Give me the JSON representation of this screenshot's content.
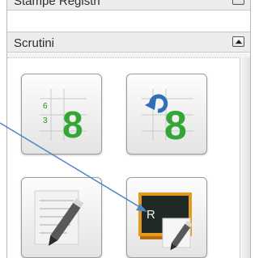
{
  "sections": {
    "stampe": {
      "title": "Stampe Registri"
    },
    "scrutini": {
      "title": "Scrutini"
    }
  },
  "tiles": [
    {
      "name": "tile-grade-8-grid",
      "icon": "grade-grid-icon",
      "small_a": "6",
      "small_b": "3",
      "grade": "8"
    },
    {
      "name": "tile-grade-8-refresh",
      "icon": "grade-refresh-icon",
      "grade": "8"
    },
    {
      "name": "tile-notes-edit",
      "icon": "notepad-pencil-icon"
    },
    {
      "name": "tile-blackboard-edit",
      "icon": "blackboard-pencil-icon",
      "board_text": "R"
    }
  ],
  "colors": {
    "grade_green": "#34a634",
    "refresh_blue": "#2f6fb8",
    "arrow_blue": "#4d86c7",
    "board_orange": "#e39a1f"
  }
}
